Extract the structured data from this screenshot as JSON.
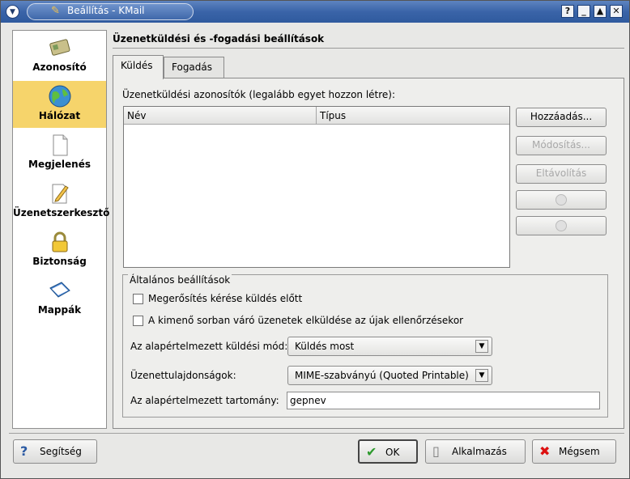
{
  "window": {
    "title": "Beállítás - KMail"
  },
  "sidebar": {
    "items": [
      {
        "label": "Azonosító",
        "icon": "identity-card-icon"
      },
      {
        "label": "Hálózat",
        "icon": "globe-icon"
      },
      {
        "label": "Megjelenés",
        "icon": "document-icon"
      },
      {
        "label": "Üzenetszerkesztő",
        "icon": "pen-paper-icon"
      },
      {
        "label": "Biztonság",
        "icon": "padlock-icon"
      },
      {
        "label": "Mappák",
        "icon": "folder-icon"
      }
    ],
    "selected": "Hálózat"
  },
  "main": {
    "heading": "Üzenetküldési és -fogadási beállítások",
    "tabs": [
      {
        "label": "Küldés",
        "active": true
      },
      {
        "label": "Fogadás",
        "active": false
      }
    ],
    "identities_label": "Üzenetküldési azonosítók (legalább egyet hozzon létre):",
    "columns": [
      "Név",
      "Típus"
    ],
    "buttons": {
      "add": "Hozzáadás...",
      "modify": "Módosítás...",
      "remove": "Eltávolítás"
    },
    "general": {
      "legend": "Általános beállítások",
      "check_confirm": "Megerősítés kérése küldés előtt",
      "check_queue": "A kimenő sorban váró üzenetek elküldése az újak ellenőrzésekor",
      "send_mode_label": "Az alapértelmezett küldési mód:",
      "send_mode_value": "Küldés most",
      "props_label": "Üzenettulajdonságok:",
      "props_value": "MIME-szabványú (Quoted Printable)",
      "domain_label": "Az alapértelmezett tartomány:",
      "domain_value": "gepnev"
    }
  },
  "footer": {
    "help": "Segítség",
    "ok": "OK",
    "apply": "Alkalmazás",
    "cancel": "Mégsem"
  },
  "colors": {
    "titlebar": "#3a64a8",
    "selection": "#f6d46b"
  }
}
